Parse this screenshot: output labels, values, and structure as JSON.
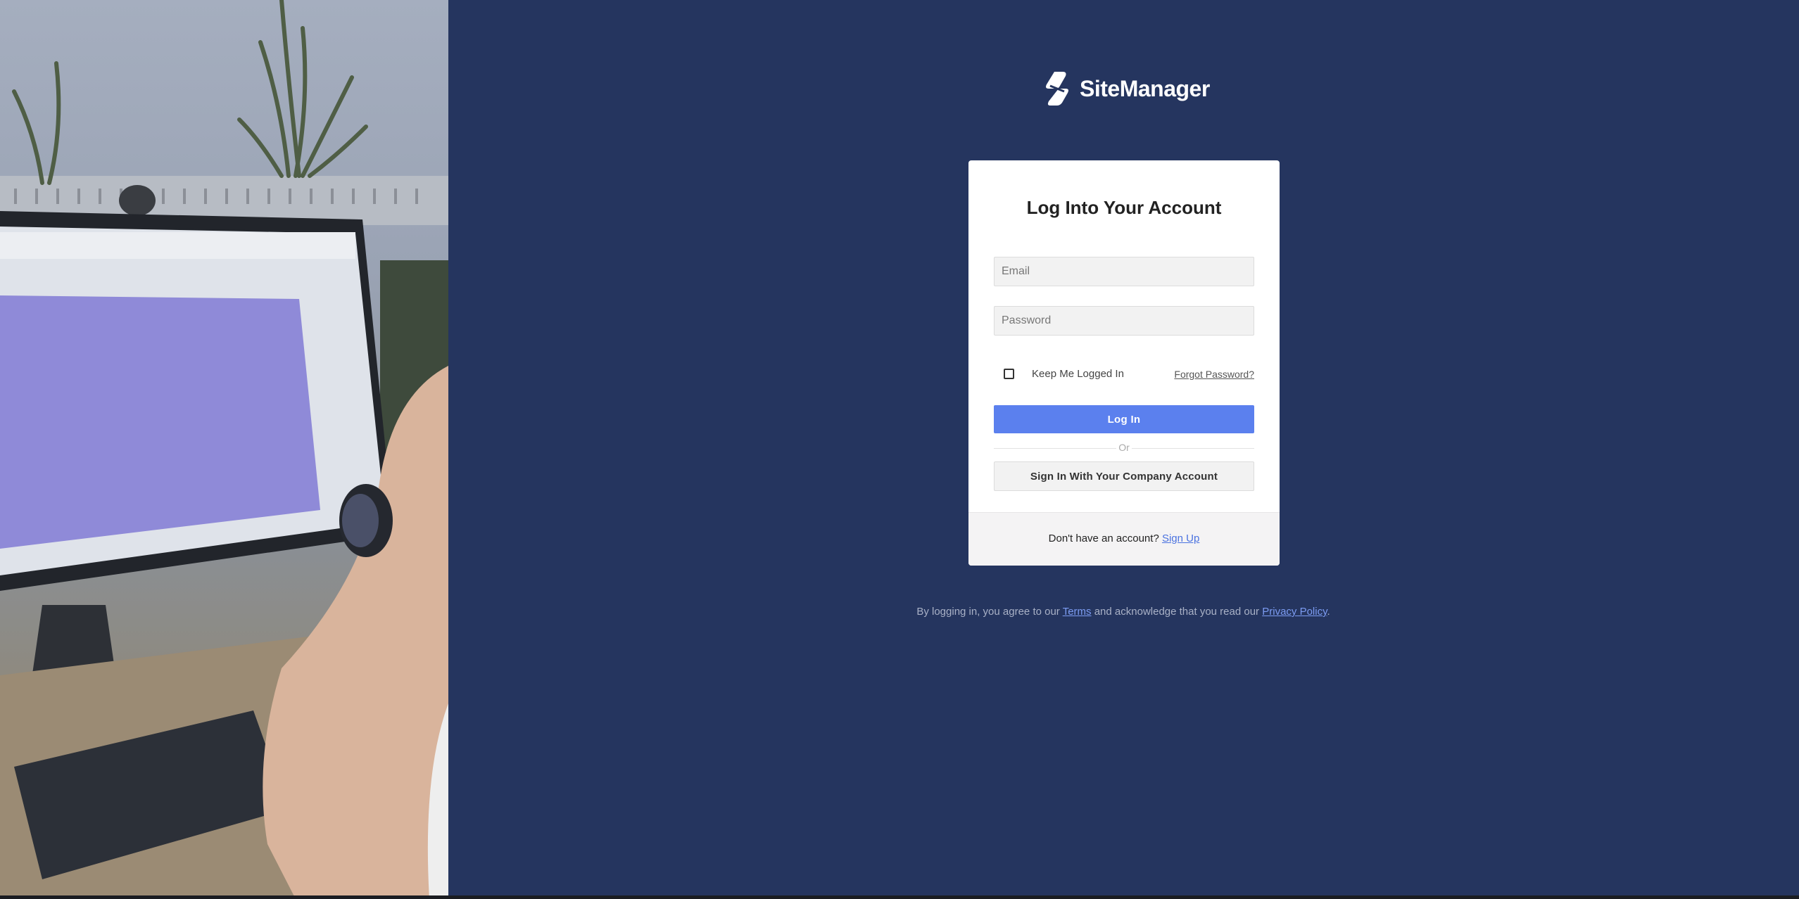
{
  "brand": {
    "name": "SiteManager",
    "logo_icon": "sitemanager-logo-icon"
  },
  "login_card": {
    "title": "Log Into Your Account",
    "email_placeholder": "Email",
    "password_placeholder": "Password",
    "remember_label": "Keep Me Logged In",
    "remember_checked": false,
    "forgot_link": "Forgot Password?",
    "login_button": "Log In",
    "divider_text": "Or",
    "sso_button": "Sign In With Your Company Account"
  },
  "signup": {
    "prompt": "Don't have an account?",
    "link": "Sign Up"
  },
  "legal": {
    "prefix": "By logging in, you agree to our",
    "terms_link": "Terms",
    "middle": "and acknowledge that you read our",
    "privacy_link": "Privacy Policy",
    "suffix": "."
  },
  "colors": {
    "background": "#25355f",
    "primary_button": "#5b80ee",
    "link": "#4a72e0"
  }
}
